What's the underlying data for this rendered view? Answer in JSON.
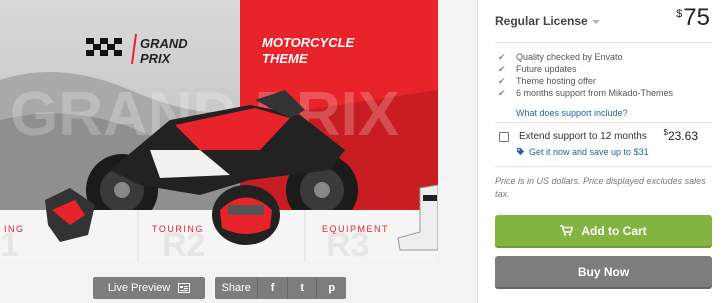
{
  "preview": {
    "logo_line1": "GRAND",
    "logo_line2": "PRIX",
    "theme_line1": "MOTORCYCLE",
    "theme_line2": "THEME",
    "bg_word": "GRAND PRIX",
    "bottom_left_label": "ING",
    "bottom_middle_label": "TOURING",
    "bottom_middle_big": "R2",
    "bottom_right_label": "EQUIPMENT",
    "bottom_right_big": "R3",
    "bottom_left_big": "1",
    "accent_color": "#e8242a"
  },
  "actions": {
    "live_preview_label": "Live Preview",
    "share_label": "Share",
    "facebook_glyph": "f",
    "twitter_glyph": "t",
    "pinterest_glyph": "p"
  },
  "license": {
    "name": "Regular License",
    "currency_symbol": "$",
    "price": "75"
  },
  "features": [
    "Quality checked by Envato",
    "Future updates",
    "Theme hosting offer",
    "6 months support from Mikado-Themes"
  ],
  "support_link": "What does support include?",
  "extend": {
    "label": "Extend support to 12 months",
    "currency_symbol": "$",
    "amount": "23.63",
    "promo": "Get it now and save up to $31"
  },
  "price_note": "Price is in US dollars. Price displayed excludes sales tax.",
  "cart_label": "Add to Cart",
  "buy_label": "Buy Now",
  "colors": {
    "cart_green": "#82b440",
    "buy_gray": "#7d7d7d",
    "link_blue": "#2164a4"
  }
}
